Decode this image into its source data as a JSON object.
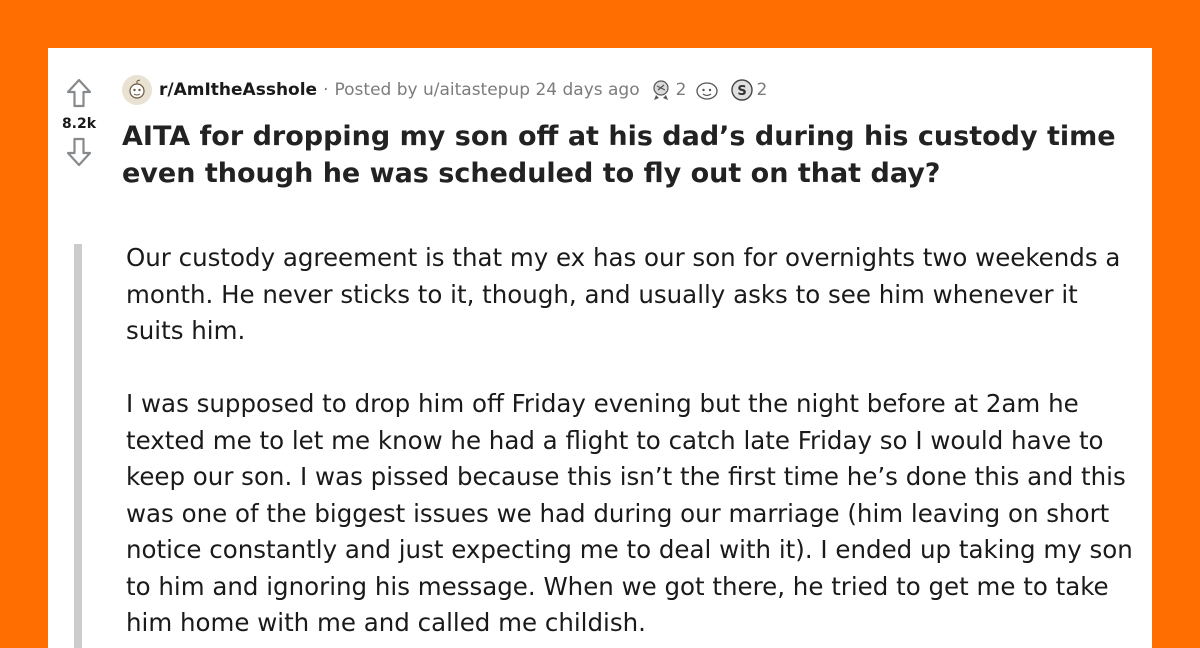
{
  "post": {
    "subreddit": "r/AmItheAsshole",
    "separator": "·",
    "posted_by": "Posted by u/aitastepup 24 days ago",
    "awards": [
      {
        "icon": "award-badge-icon",
        "count": "2"
      },
      {
        "icon": "wholesome-face-icon",
        "count": ""
      },
      {
        "icon": "silver-coin-icon",
        "count": "2"
      }
    ],
    "votes": "8.2k",
    "title": "AITA for dropping my son off at his dad’s during his custody time even though he was scheduled to fly out on that day?",
    "paragraphs": [
      "Our custody agreement is that my ex has our son for overnights two weekends a month. He never sticks to it, though, and usually asks to see him whenever it suits him.",
      "I was supposed to drop him off Friday evening but the night before at 2am he texted me to let me know he had a flight to catch late Friday so I would have to keep our son. I was pissed because this isn’t the first time he’s done this and this was one of the biggest issues we had during our marriage (him leaving on short notice constantly and just expecting me to deal with it). I ended up taking my son to him and ignoring his message. When we got there, he tried to get me to take him home with me and called me childish."
    ]
  },
  "colors": {
    "background": "#ff6e00",
    "card": "#ffffff",
    "quote_bar": "#cccccc",
    "meta_text": "#7c7c7c",
    "title_text": "#222222"
  }
}
